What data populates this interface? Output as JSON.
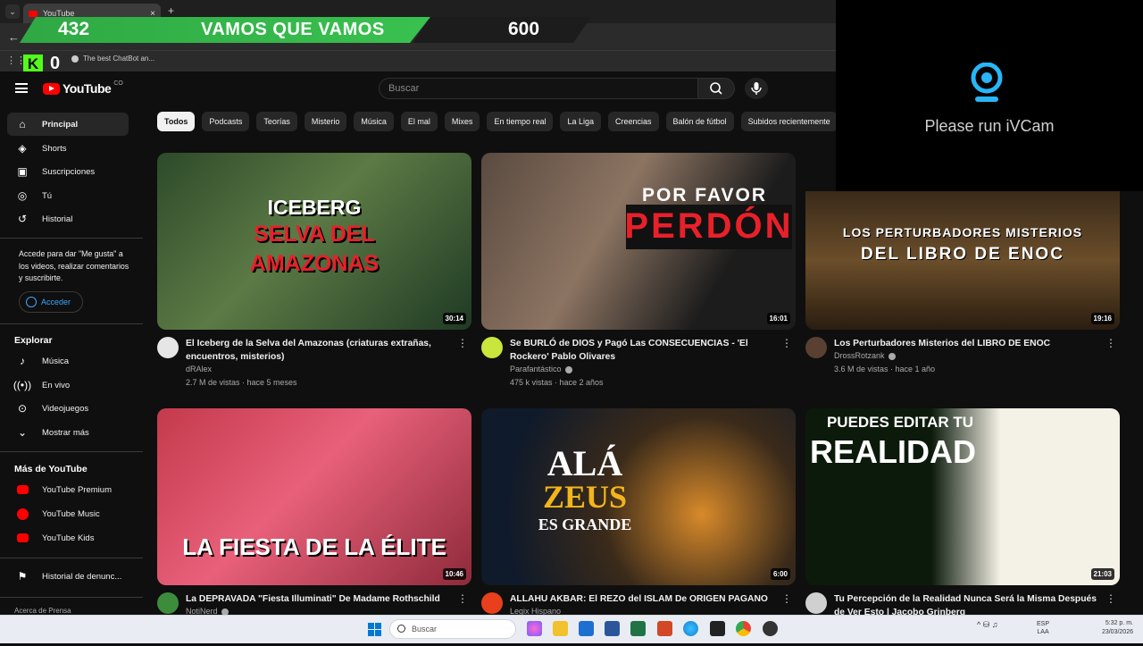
{
  "browser": {
    "tab_title": "YouTube",
    "tab_close": "×",
    "new_tab": "+",
    "tab_menu": "⌄",
    "back": "←",
    "apps_icon": "⋮⋮",
    "bookmark_label": "The best ChatBot an..."
  },
  "overlay": {
    "left_count": "432",
    "title": "VAMOS QUE VAMOS",
    "goal": "600",
    "kick_logo": "K",
    "kick_count": "0"
  },
  "webcam": {
    "message": "Please run iVCam"
  },
  "header": {
    "wordmark": "YouTube",
    "country": "CO",
    "search_placeholder": "Buscar"
  },
  "sidebar": {
    "primary": [
      {
        "label": "Principal",
        "icon": "home-icon"
      },
      {
        "label": "Shorts",
        "icon": "shorts-icon"
      },
      {
        "label": "Suscripciones",
        "icon": "subscriptions-icon"
      },
      {
        "label": "Tú",
        "icon": "you-icon"
      },
      {
        "label": "Historial",
        "icon": "history-icon"
      }
    ],
    "signin_note": "Accede para dar \"Me gusta\" a los videos, realizar comentarios y suscribirte.",
    "signin_button": "Acceder",
    "explore_heading": "Explorar",
    "explore": [
      {
        "label": "Música",
        "icon": "music-icon"
      },
      {
        "label": "En vivo",
        "icon": "live-icon"
      },
      {
        "label": "Videojuegos",
        "icon": "gaming-icon"
      },
      {
        "label": "Mostrar más",
        "icon": "chevron-down-icon"
      }
    ],
    "more_heading": "Más de YouTube",
    "more": [
      {
        "label": "YouTube Premium",
        "icon": "youtube-premium-icon"
      },
      {
        "label": "YouTube Music",
        "icon": "youtube-music-icon"
      },
      {
        "label": "YouTube Kids",
        "icon": "youtube-kids-icon"
      }
    ],
    "report": "Historial de denunc...",
    "footer": "Acerca de   Prensa"
  },
  "chips": [
    "Todos",
    "Podcasts",
    "Teorías",
    "Misterio",
    "Música",
    "El mal",
    "Mixes",
    "En tiempo real",
    "La Liga",
    "Creencias",
    "Balón de fútbol",
    "Subidos recientemente"
  ],
  "videos": [
    {
      "thumb_lines": [
        "ICEBERG",
        "SELVA DEL",
        "AMAZONAS"
      ],
      "duration": "30:14",
      "title": "El Iceberg de la Selva del Amazonas (criaturas extrañas, encuentros, misterios)",
      "channel": "dRAlex",
      "meta": "2.7 M de vistas · hace 5 meses",
      "verified": false,
      "avatar_color": "#e6e6e6"
    },
    {
      "thumb_lines": [
        "POR FAVOR",
        "PERDÓN"
      ],
      "duration": "16:01",
      "title": "Se BURLÓ de DIOS y Pagó Las CONSECUENCIAS - 'El Rockero' Pablo Olivares",
      "channel": "Parafantástico",
      "meta": "475 k vistas · hace 2 años",
      "verified": true,
      "avatar_color": "#c8e63c"
    },
    {
      "thumb_lines": [
        "LOS PERTURBADORES MISTERIOS",
        "DEL LIBRO DE ENOC"
      ],
      "duration": "19:16",
      "title": "Los Perturbadores Misterios del LIBRO DE ENOC",
      "channel": "DrossRotzank",
      "meta": "3.6 M de vistas · hace 1 año",
      "verified": true,
      "avatar_color": "#5a4030"
    },
    {
      "thumb_lines": [
        "LA FIESTA DE LA ÉLITE"
      ],
      "duration": "10:46",
      "title": "La DEPRAVADA \"Fiesta Illuminati\" De Madame Rothschild",
      "channel": "NotiNerd",
      "meta": "",
      "verified": true,
      "avatar_color": "#3c8c3c"
    },
    {
      "thumb_lines": [
        "ALÁ",
        "ZEUS",
        "ES GRANDE"
      ],
      "duration": "6:00",
      "title": "ALLAHU AKBAR: El REZO del ISLAM De ORIGEN PAGANO",
      "channel": "Legix Hispano",
      "meta": "",
      "verified": false,
      "avatar_color": "#e8401c"
    },
    {
      "thumb_lines": [
        "PUEDES EDITAR TU",
        "REALIDAD"
      ],
      "duration": "21:03",
      "title": "Tu Percepción de la Realidad Nunca Será la Misma Después de Ver Esto | Jacobo Grinberg",
      "channel": "",
      "meta": "",
      "verified": false,
      "avatar_color": "#d0d0d0"
    }
  ],
  "taskbar": {
    "search": "Buscar",
    "lang": "ESP\nLAA",
    "time": "5:32 p. m.",
    "date": "23/03/2026",
    "tray": "^  ⛁  ♫"
  },
  "colors": {
    "accent_red": "#ff0000",
    "link_blue": "#3ea6ff",
    "overlay_green": "#39c24f",
    "kick_green": "#53fc18"
  }
}
